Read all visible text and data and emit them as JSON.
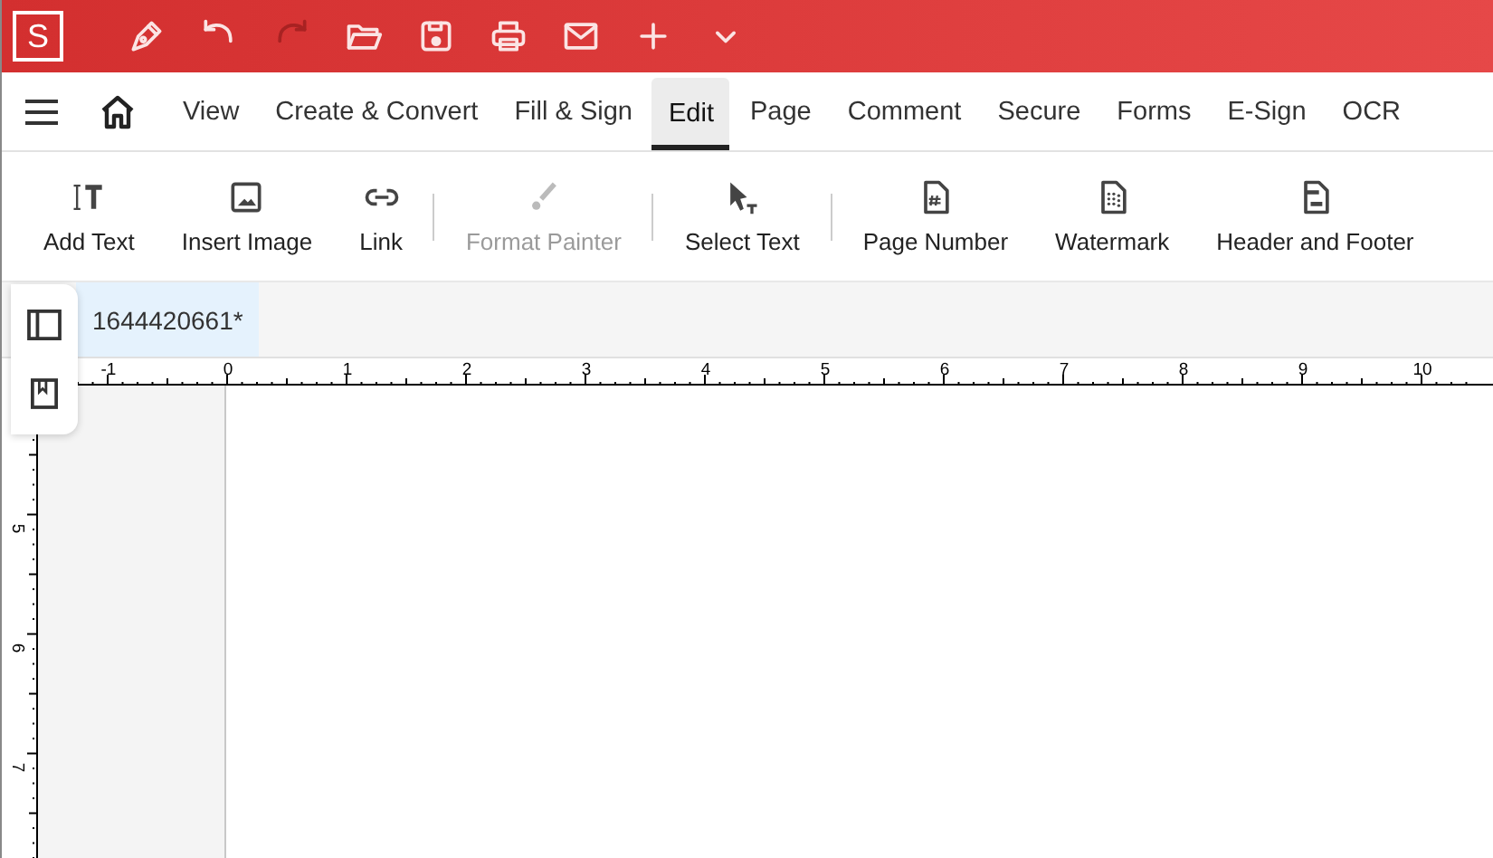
{
  "app_logo": "S",
  "quick_actions": [
    {
      "disabled": false
    },
    {
      "disabled": false
    },
    {
      "disabled": true
    },
    {
      "disabled": false
    },
    {
      "disabled": false
    },
    {
      "disabled": false
    },
    {
      "disabled": false
    },
    {
      "disabled": false
    },
    {
      "disabled": false
    }
  ],
  "menu_tabs": [
    {
      "label": "View",
      "selected": false
    },
    {
      "label": "Create & Convert",
      "selected": false
    },
    {
      "label": "Fill & Sign",
      "selected": false
    },
    {
      "label": "Edit",
      "selected": true
    },
    {
      "label": "Page",
      "selected": false
    },
    {
      "label": "Comment",
      "selected": false
    },
    {
      "label": "Secure",
      "selected": false
    },
    {
      "label": "Forms",
      "selected": false
    },
    {
      "label": "E-Sign",
      "selected": false
    },
    {
      "label": "OCR",
      "selected": false
    }
  ],
  "tools": [
    {
      "label": "Add Text",
      "disabled": false,
      "separator_after": false
    },
    {
      "label": "Insert Image",
      "disabled": false,
      "separator_after": false
    },
    {
      "label": "Link",
      "disabled": false,
      "separator_after": true
    },
    {
      "label": "Format Painter",
      "disabled": true,
      "separator_after": true
    },
    {
      "label": "Select Text",
      "disabled": false,
      "separator_after": true
    },
    {
      "label": "Page Number",
      "disabled": false,
      "separator_after": false
    },
    {
      "label": "Watermark",
      "disabled": false,
      "separator_after": false
    },
    {
      "label": "Header and Footer",
      "disabled": false,
      "separator_after": false
    }
  ],
  "document_tabs": [
    {
      "label": "1644420661*",
      "selected": true
    }
  ],
  "ruler": {
    "horizontal_labels": [
      "-1",
      "0",
      "1",
      "2",
      "3",
      "4",
      "5",
      "6",
      "7",
      "8",
      "9",
      "10"
    ],
    "vertical_labels": [
      "5",
      "6",
      "7"
    ]
  }
}
